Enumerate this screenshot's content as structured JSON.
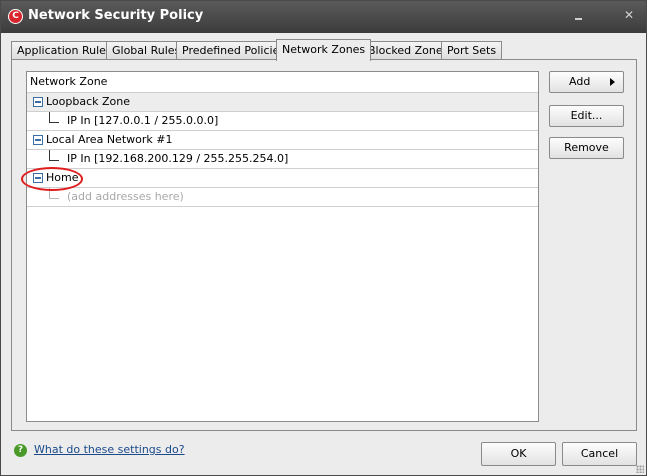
{
  "window": {
    "title": "Network Security Policy",
    "app_icon": "C",
    "minimize_icon": "minimize-icon",
    "close_icon": "close-icon",
    "close_glyph": "✕"
  },
  "tabs": [
    {
      "label": "Application Rules",
      "active": false
    },
    {
      "label": "Global Rules",
      "active": false
    },
    {
      "label": "Predefined Policies",
      "active": false
    },
    {
      "label": "Network Zones",
      "active": true
    },
    {
      "label": "Blocked Zones",
      "active": false
    },
    {
      "label": "Port Sets",
      "active": false
    }
  ],
  "tree": {
    "header": "Network Zone",
    "zones": [
      {
        "name": "Loopback Zone",
        "child": "IP In [127.0.0.1 / 255.0.0.0]",
        "child_is_hint": false
      },
      {
        "name": "Local Area Network #1",
        "child": "IP In [192.168.200.129 / 255.255.254.0]",
        "child_is_hint": false
      },
      {
        "name": "Home",
        "child": "(add addresses here)",
        "child_is_hint": true,
        "highlighted": true
      }
    ]
  },
  "side_buttons": {
    "add": "Add",
    "edit": "Edit...",
    "remove": "Remove"
  },
  "footer": {
    "help_icon": "?",
    "help_link": "What do these settings do?",
    "ok": "OK",
    "cancel": "Cancel"
  },
  "colors": {
    "titlebar": "#3c3c3c",
    "app_icon": "#d9262c",
    "highlight_ring": "#e01b1b",
    "link": "#1a4a8a",
    "help_icon": "#4a9a2a"
  }
}
